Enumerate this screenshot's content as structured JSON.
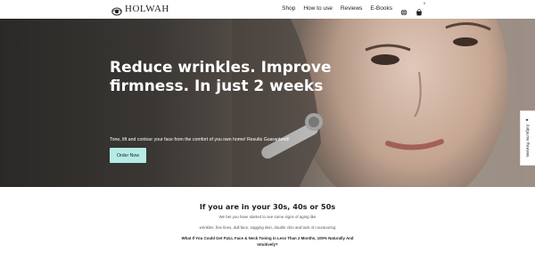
{
  "header": {
    "logo_text": "HOLWAH",
    "nav": [
      "Shop",
      "How to use",
      "Reviews",
      "E-Books"
    ],
    "icons": [
      "globe-icon",
      "cart-icon"
    ],
    "cart_count": "0"
  },
  "hero": {
    "title": "Reduce wrinkles. Improve firmness. In just 2 weeks",
    "subtitle": "Tone, lift and contour your face from the comfort of you own home! Results Guaranteed!",
    "cta_label": "Order Now",
    "cta_color": "#b6ece6"
  },
  "side_widget": {
    "label": "★ Judge.me Reviews"
  },
  "section": {
    "title": "If you are in your 30s, 40s or 50s",
    "line1": "We bet you have started to see some signs of aging like",
    "line2": "wrinkles, fine lines, dull face, sagging skin, double chin and lack of countouring",
    "line3": "What If You Could Get FULL Face & Neck Toning in Less Than 2 Months, 100% Naturally And Intuitively?"
  }
}
